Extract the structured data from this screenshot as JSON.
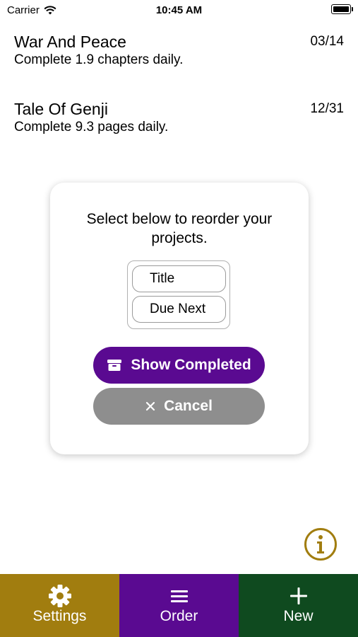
{
  "status_bar": {
    "carrier": "Carrier",
    "time": "10:45 AM"
  },
  "projects": [
    {
      "title": "War And Peace",
      "goal": "Complete 1.9 chapters daily.",
      "due": "03/14"
    },
    {
      "title": "Tale Of Genji",
      "goal": "Complete 9.3 pages daily.",
      "due": "12/31"
    }
  ],
  "modal": {
    "message": "Select below to reorder your projects.",
    "options": [
      "Title",
      "Due Next"
    ],
    "show_completed_label": "Show Completed",
    "cancel_label": "Cancel"
  },
  "tabs": [
    {
      "label": "Settings",
      "icon": "gear-icon",
      "color": "#a17d0f"
    },
    {
      "label": "Order",
      "icon": "list-icon",
      "color": "#5a0a91"
    },
    {
      "label": "New",
      "icon": "plus-icon",
      "color": "#0f4a1f"
    }
  ],
  "colors": {
    "accent_gold": "#a17d0f",
    "accent_purple": "#5a0a91",
    "cancel_gray": "#8e8e8e"
  }
}
